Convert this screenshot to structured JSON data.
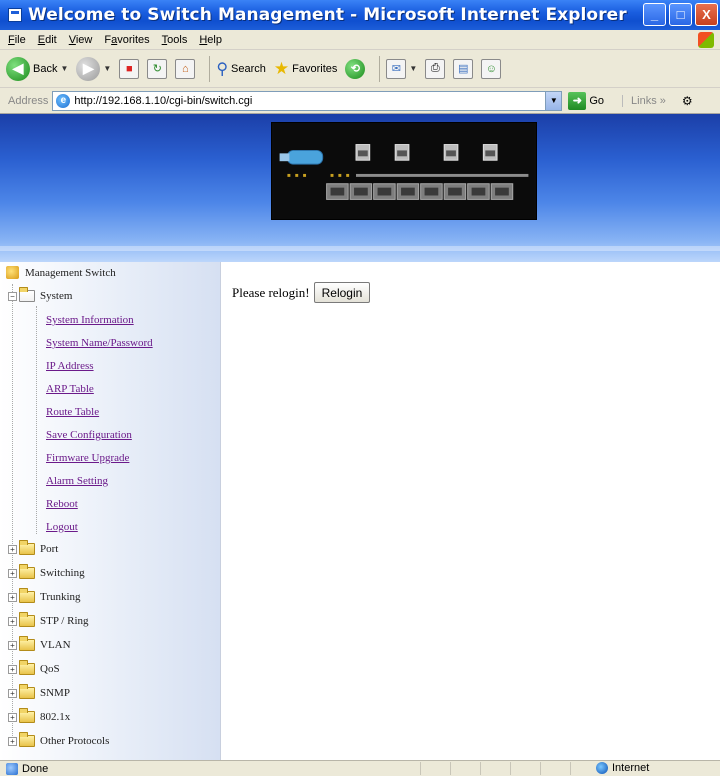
{
  "window": {
    "title": "Welcome to Switch Management - Microsoft Internet Explorer",
    "buttons": {
      "minimize": "_",
      "maximize": "□",
      "close": "X"
    }
  },
  "menubar": {
    "items": [
      {
        "label": "File",
        "key": "F"
      },
      {
        "label": "Edit",
        "key": "E"
      },
      {
        "label": "View",
        "key": "V"
      },
      {
        "label": "Favorites",
        "key": "a"
      },
      {
        "label": "Tools",
        "key": "T"
      },
      {
        "label": "Help",
        "key": "H"
      }
    ]
  },
  "toolbar": {
    "back": "Back",
    "search": "Search",
    "favorites": "Favorites"
  },
  "address": {
    "label": "Address",
    "url": "http://192.168.1.10/cgi-bin/switch.cgi",
    "go": "Go",
    "links": "Links"
  },
  "tree": {
    "root": "Management Switch",
    "system": "System",
    "system_links": [
      "System Information",
      "System Name/Password",
      "IP Address",
      "ARP Table",
      "Route Table",
      "Save Configuration",
      "Firmware Upgrade",
      "Alarm Setting",
      "Reboot",
      "Logout"
    ],
    "folders": [
      "Port",
      "Switching",
      "Trunking",
      "STP / Ring",
      "VLAN",
      "QoS",
      "SNMP",
      "802.1x",
      "Other Protocols"
    ]
  },
  "content": {
    "message": "Please relogin!",
    "relogin_button": "Relogin"
  },
  "status": {
    "text": "Done",
    "zone": "Internet"
  },
  "colors": {
    "titlebar": "#1a5ee0",
    "link_visited": "#6b1a8a",
    "banner_top": "#1b3fa8"
  }
}
